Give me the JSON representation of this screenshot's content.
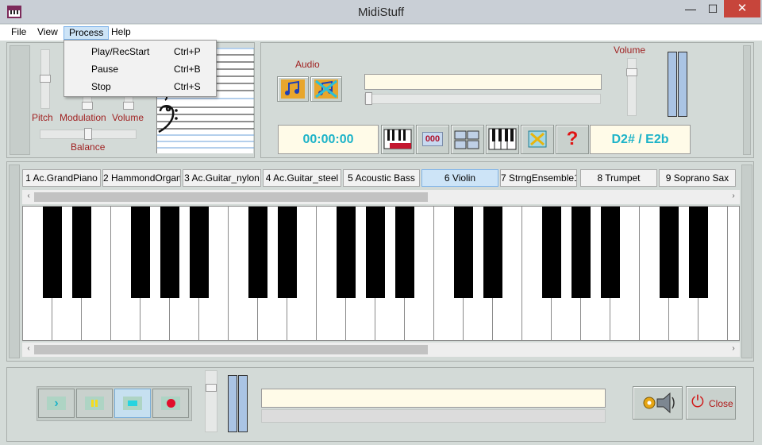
{
  "window": {
    "title": "MidiStuff",
    "min_glyph": "—",
    "max_glyph": "☐",
    "close_glyph": "✕"
  },
  "menu": [
    "File",
    "View",
    "Process",
    "Help"
  ],
  "active_menu": "Process",
  "dropdown": [
    {
      "label": "Play/RecStart",
      "shortcut": "Ctrl+P"
    },
    {
      "label": "Pause",
      "shortcut": "Ctrl+B"
    },
    {
      "label": "Stop",
      "shortcut": "Ctrl+S"
    }
  ],
  "controls": {
    "pitch_label": "Pitch",
    "modulation_label": "Modulation",
    "volume_label": "Volume",
    "balance_label": "Balance",
    "audio_label": "Audio",
    "master_volume_label": "Volume"
  },
  "display": {
    "time": "00:00:00",
    "counter": "000",
    "note": "D2# / E2b",
    "help_glyph": "?"
  },
  "instruments": [
    "1 Ac.GrandPiano",
    "2 HammondOrgan",
    "3 Ac.Guitar_nylon",
    "4 Ac.Guitar_steel",
    "5 Acoustic Bass",
    "6 Violin",
    "7 StrngEnsemble1",
    "8 Trumpet",
    "9 Soprano Sax"
  ],
  "selected_instrument": "6 Violin",
  "scroll_arrows": {
    "left": "‹",
    "right": "›"
  },
  "bottom": {
    "close_label": "Close",
    "power_glyph": "⏻"
  },
  "colors": {
    "accent_cyan": "#1cb3c8",
    "label_red": "#a02222",
    "selected_tab": "#cde4f7",
    "record": "#e0102a"
  }
}
